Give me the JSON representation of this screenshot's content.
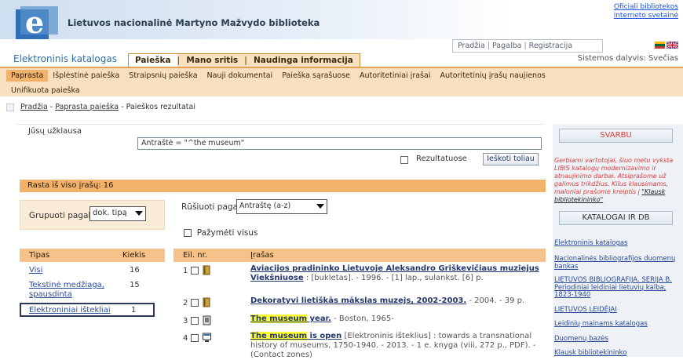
{
  "header": {
    "library_title": "Lietuvos nacionalinė Martyno Mažvydo biblioteka",
    "official_link": "Oficiali bibliotekos interneto svetainė",
    "top_links": [
      "Pradžia",
      "Pagalba",
      "Registracija"
    ],
    "catalog_title": "Elektroninis katalogas",
    "system_user": "Sistemos dalyvis: Svečias",
    "colors": {
      "accent_orange": "#f2b26a",
      "link_blue": "#2a4a9a",
      "warning_red": "#e23a3a"
    }
  },
  "main_tabs": [
    "Paieška",
    "Mano sritis",
    "Naudinga informacija"
  ],
  "subnav": {
    "row1": [
      "Paprasta",
      "Išplėstinė paieška",
      "Straipsnių paieška",
      "Nauji dokumentai",
      "Paieška sąrašuose",
      "Autoritetiniai įrašai",
      "Autoritetinių įrašų naujienos"
    ],
    "row2": [
      "Unifikuota paieška"
    ]
  },
  "breadcrumb": {
    "home": "Pradžia",
    "simple": "Paprasta paieška",
    "current": "Paieškos rezultatai"
  },
  "query": {
    "label": "Jūsų užklausa",
    "value": "Antraštė = \"^the museum\"",
    "within_results_label": "Rezultatuose",
    "search_more_button": "Ieškoti toliau"
  },
  "results_summary": "Rasta iš viso įrašų: 16",
  "group": {
    "label": "Grupuoti pagal",
    "selected": "dok. tipą",
    "table_headers": [
      "Tipas",
      "Kiekis"
    ],
    "rows": [
      {
        "type": "Visi",
        "count": "16"
      },
      {
        "type": "Tekstinė medžiaga, spausdinta",
        "count": "15"
      },
      {
        "type": "Elektroniniai ištekliai",
        "count": "1"
      }
    ]
  },
  "sort": {
    "label": "Rūšiuoti pagal",
    "selected": "Antraštę (a-z)"
  },
  "mark_all_label": "Pažymėti visus",
  "results": {
    "headers": [
      "Eil. nr.",
      "Įrašas"
    ],
    "items": [
      {
        "num": "1",
        "icon": "book-icon",
        "title": "Aviacijos pradininko Lietuvoje Aleksandro Griškevičiaus muziejus Viekšniuose",
        "rest": " : [bukletas]. - 1996. - [1] lap., sulankst. [6] p."
      },
      {
        "num": "2",
        "icon": "book-icon",
        "title": "Dekoratyvi lietiškās mākslas muzejs, 2002-2003.",
        "rest": " - 2004. - 39 p."
      },
      {
        "num": "3",
        "icon": "book-icon",
        "title_hl": "The museum",
        "title": " year.",
        "rest": " - Boston, 1965-"
      },
      {
        "num": "4",
        "icon": "monitor-icon",
        "title_hl": "The museum",
        "title": " is open",
        "rest": " [Elektroninis išteklius] : towards a transnational history of museums, 1750-1940. - 2013. - 1 e. knyga (viii, 272 p., PDF). - (Contact zones)"
      }
    ]
  },
  "sidebar": {
    "important_box": "SVARBU",
    "warning_text": "Gerbiami vartotojai, šiuo metu vyksta LIBIS katalogų modernizavimo ir atnaujinimo darbai. Atsiprašome už galimus trikdžius. Kilus klausimams, maloniai prašome kreiptis į",
    "warning_link": "\"Klausk bibliotekininko\"",
    "catalogs_box": "KATALOGAI IR DB",
    "links": [
      "Elektroninis katalogas",
      "Nacionalinės bibliografijos duomenų bankas",
      "LIETUVOS BIBLIOGRAFIJA. SERIJA B. Periodiniai leidiniai lietuvių kalba, 1823-1940",
      "LIETUVOS LEIDĖJAI",
      "Leidinių mainams katalogas",
      "Duomenų bazės",
      "Klausk bibliotekininko"
    ]
  }
}
